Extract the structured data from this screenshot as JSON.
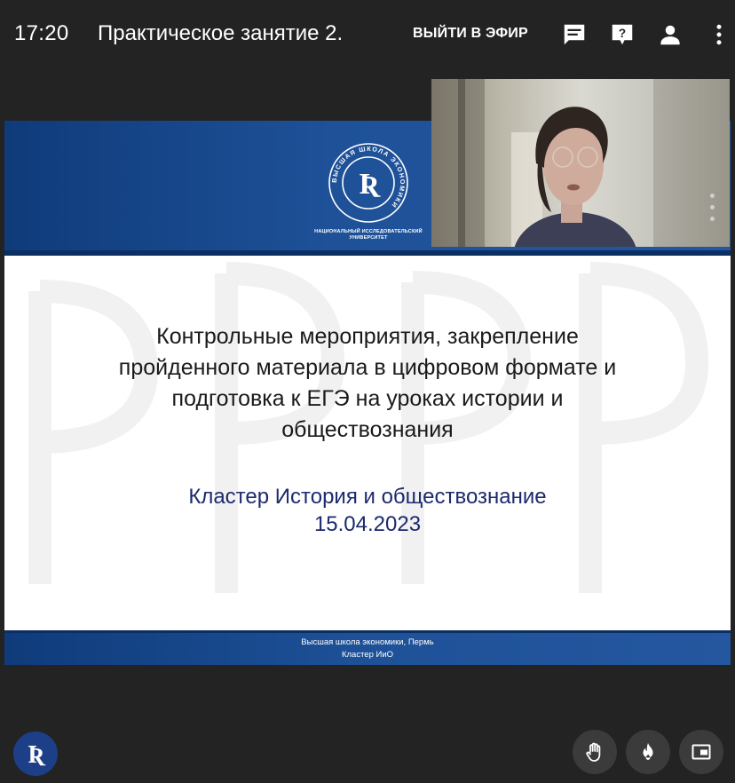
{
  "header": {
    "time": "17:20",
    "title": "Практическое занятие 2.",
    "go_live_label": "ВЫЙТИ В ЭФИР",
    "icons": [
      "chat-icon",
      "help-icon",
      "person-icon",
      "more-vert-icon"
    ]
  },
  "slide": {
    "university_caption_line1": "НАЦИОНАЛЬНЫЙ ИССЛЕДОВАТЕЛЬСКИЙ",
    "university_caption_line2": "УНИВЕРСИТЕТ",
    "logo_ring_text": "ВЫСШАЯ ШКОЛА ЭКОНОМИКИ",
    "main_lines": [
      "Контрольные мероприятия, закрепление",
      "пройденного материала в цифровом формате и",
      "подготовка к ЕГЭ на уроках истории и",
      "обществознания"
    ],
    "cluster": "Кластер История и обществознание",
    "date": "15.04.2023",
    "footer_line1": "Высшая школа экономики, Пермь",
    "footer_line2": "Кластер ИиО"
  },
  "bottom": {
    "buttons": [
      "raise-hand-icon",
      "fire-icon",
      "picture-in-picture-icon"
    ]
  },
  "colors": {
    "background": "#232323",
    "slide_blue": "#1e5198",
    "cluster_text": "#1c2a6e",
    "button_bg": "#3b3b3b"
  }
}
